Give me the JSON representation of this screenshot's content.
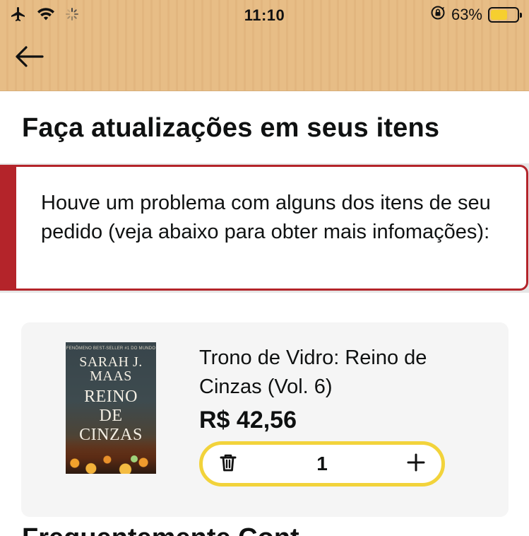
{
  "status_bar": {
    "time": "11:10",
    "battery_percent": "63%",
    "battery_level": 0.63,
    "icons": [
      "airplane-icon",
      "wifi-icon",
      "loading-spinner-icon",
      "rotation-lock-icon",
      "battery-icon"
    ]
  },
  "nav": {
    "back_icon": "arrow-left-icon"
  },
  "page": {
    "title": "Faça atualizações em seus itens"
  },
  "alert": {
    "message": "Houve um problema com alguns dos itens de seu pedido (veja abaixo para obter mais infomações):",
    "accent_color": "#b4242a"
  },
  "product": {
    "cover": {
      "tagline": "FENÔMENO BEST-SELLER #1 DO MUNDO",
      "author_line1": "SARAH J.",
      "author_line2": "MAAS",
      "title_line1": "REINO",
      "title_line2": "DE",
      "title_line3": "CINZAS"
    },
    "title": "Trono de Vidro: Reino de Cinzas (Vol. 6)",
    "price": "R$ 42,56",
    "quantity": "1",
    "delete_icon": "trash-icon",
    "add_icon": "plus-icon",
    "stepper_border_color": "#f2d33b"
  },
  "next_section": {
    "heading": "Frequentemente Cont..."
  }
}
